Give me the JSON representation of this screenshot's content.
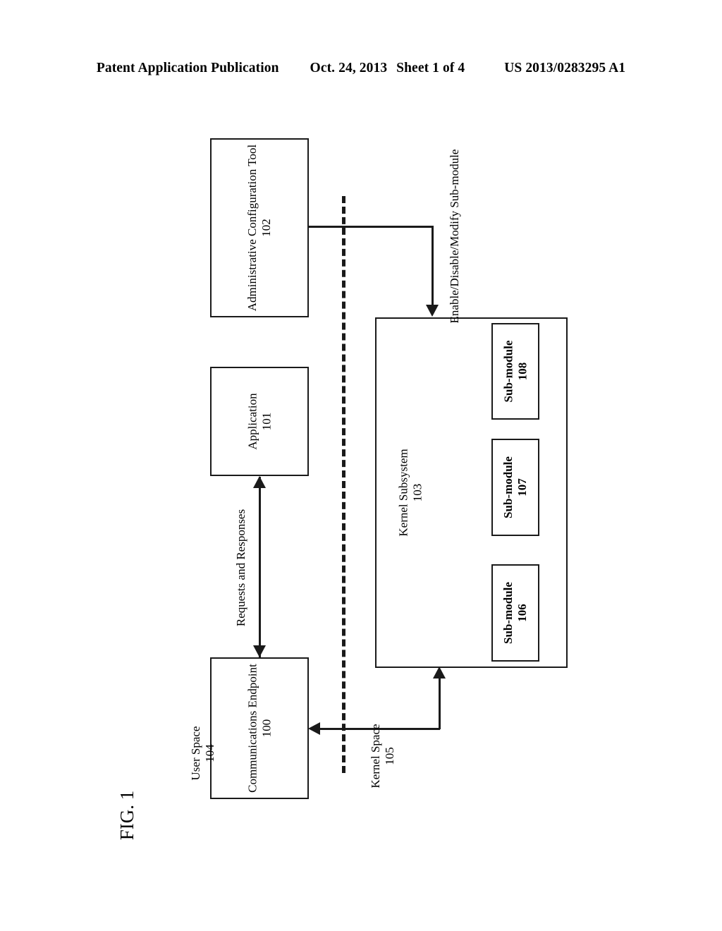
{
  "header": {
    "publication": "Patent Application Publication",
    "date": "Oct. 24, 2013",
    "sheet": "Sheet 1 of 4",
    "document_number": "US 2013/0283295 A1"
  },
  "figure": {
    "caption": "FIG. 1",
    "boxes": {
      "admin_tool": {
        "title": "Administrative Configuration Tool",
        "ref": "102"
      },
      "application": {
        "title": "Application",
        "ref": "101"
      },
      "comm_endpoint": {
        "title": "Communications Endpoint",
        "ref": "100"
      },
      "kernel_subsystem": {
        "title": "Kernel Subsystem",
        "ref": "103"
      },
      "submodule_106": {
        "title": "Sub-module",
        "ref": "106"
      },
      "submodule_107": {
        "title": "Sub-module",
        "ref": "107"
      },
      "submodule_108": {
        "title": "Sub-module",
        "ref": "108"
      }
    },
    "regions": {
      "user_space": {
        "title": "User Space",
        "ref": "104"
      },
      "kernel_space": {
        "title": "Kernel Space",
        "ref": "105"
      }
    },
    "connectors": {
      "config_action": "Enable/Disable/Modify Sub-module",
      "requests_responses": "Requests and Responses"
    }
  }
}
